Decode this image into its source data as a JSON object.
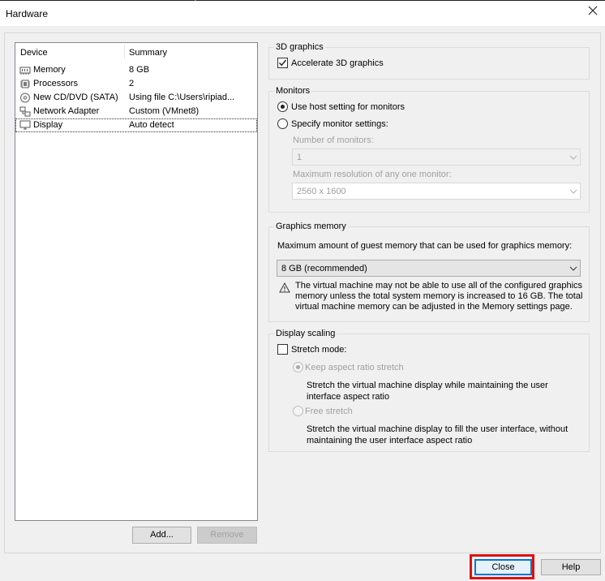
{
  "window": {
    "title": "Hardware"
  },
  "device_list": {
    "columns": {
      "device": "Device",
      "summary": "Summary"
    },
    "rows": [
      {
        "device": "Memory",
        "summary": "8 GB",
        "icon": "memory-icon"
      },
      {
        "device": "Processors",
        "summary": "2",
        "icon": "processor-icon"
      },
      {
        "device": "New CD/DVD (SATA)",
        "summary": "Using file C:\\Users\\ripiad...",
        "icon": "cd-dvd-icon"
      },
      {
        "device": "Network Adapter",
        "summary": "Custom (VMnet8)",
        "icon": "network-adapter-icon"
      },
      {
        "device": "Display",
        "summary": "Auto detect",
        "icon": "display-icon",
        "selected": true
      }
    ],
    "add_label": "Add...",
    "remove_label": "Remove"
  },
  "graphics3d": {
    "group_label": "3D graphics",
    "accelerate_label": "Accelerate 3D graphics",
    "accelerate_checked": true
  },
  "monitors": {
    "group_label": "Monitors",
    "host_setting_label": "Use host setting for monitors",
    "specify_label": "Specify monitor settings:",
    "selected": "host",
    "number_label": "Number of monitors:",
    "number_value": "1",
    "resolution_label": "Maximum resolution of any one monitor:",
    "resolution_value": "2560 x 1600"
  },
  "graphics_memory": {
    "group_label": "Graphics memory",
    "description": "Maximum amount of guest memory that can be used for graphics memory:",
    "value": "8 GB (recommended)",
    "warning": "The virtual machine may not be able to use all of the configured graphics memory unless the total system memory is increased to 16 GB. The total virtual machine memory can be adjusted in the Memory settings page."
  },
  "display_scaling": {
    "group_label": "Display scaling",
    "stretch_label": "Stretch mode:",
    "stretch_checked": false,
    "keep_aspect_label": "Keep aspect ratio stretch",
    "keep_aspect_desc": "Stretch the virtual machine display while maintaining the user interface aspect ratio",
    "free_stretch_label": "Free stretch",
    "free_stretch_desc": "Stretch the virtual machine display to fill the user interface, without maintaining the user interface aspect ratio"
  },
  "footer": {
    "close_label": "Close",
    "help_label": "Help"
  },
  "colors": {
    "highlight": "#e01010",
    "focus_border": "#0078d7",
    "disabled_text": "#a0a0a0"
  }
}
